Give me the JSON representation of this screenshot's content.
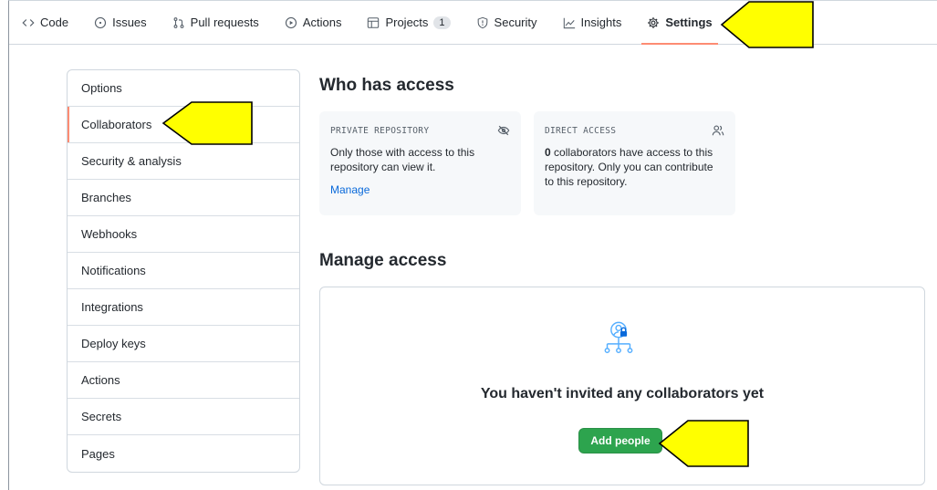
{
  "nav": {
    "tabs": [
      {
        "label": "Code",
        "icon": "code-icon"
      },
      {
        "label": "Issues",
        "icon": "issue-icon"
      },
      {
        "label": "Pull requests",
        "icon": "pull-request-icon"
      },
      {
        "label": "Actions",
        "icon": "play-icon"
      },
      {
        "label": "Projects",
        "icon": "table-icon",
        "count": "1"
      },
      {
        "label": "Security",
        "icon": "shield-icon"
      },
      {
        "label": "Insights",
        "icon": "graph-icon"
      },
      {
        "label": "Settings",
        "icon": "gear-icon",
        "active": true
      }
    ]
  },
  "sidebar": {
    "items": [
      {
        "label": "Options"
      },
      {
        "label": "Collaborators",
        "selected": true
      },
      {
        "label": "Security & analysis"
      },
      {
        "label": "Branches"
      },
      {
        "label": "Webhooks"
      },
      {
        "label": "Notifications"
      },
      {
        "label": "Integrations"
      },
      {
        "label": "Deploy keys"
      },
      {
        "label": "Actions"
      },
      {
        "label": "Secrets"
      },
      {
        "label": "Pages"
      }
    ]
  },
  "access": {
    "title": "Who has access",
    "private_card": {
      "heading": "PRIVATE REPOSITORY",
      "icon": "eye-closed-icon",
      "body": "Only those with access to this repository can view it.",
      "link": "Manage"
    },
    "direct_card": {
      "heading": "DIRECT ACCESS",
      "icon": "people-icon",
      "count": "0",
      "body": " collaborators have access to this repository. Only you can contribute to this repository."
    }
  },
  "manage": {
    "title": "Manage access",
    "empty_icon": "organization-lock-icon",
    "empty_title": "You haven't invited any collaborators yet",
    "add_button": "Add people"
  },
  "colors": {
    "accent_underline": "#fd8c73",
    "link": "#0969da",
    "primary_button": "#2da44e",
    "callout_fill": "#ffff00"
  }
}
